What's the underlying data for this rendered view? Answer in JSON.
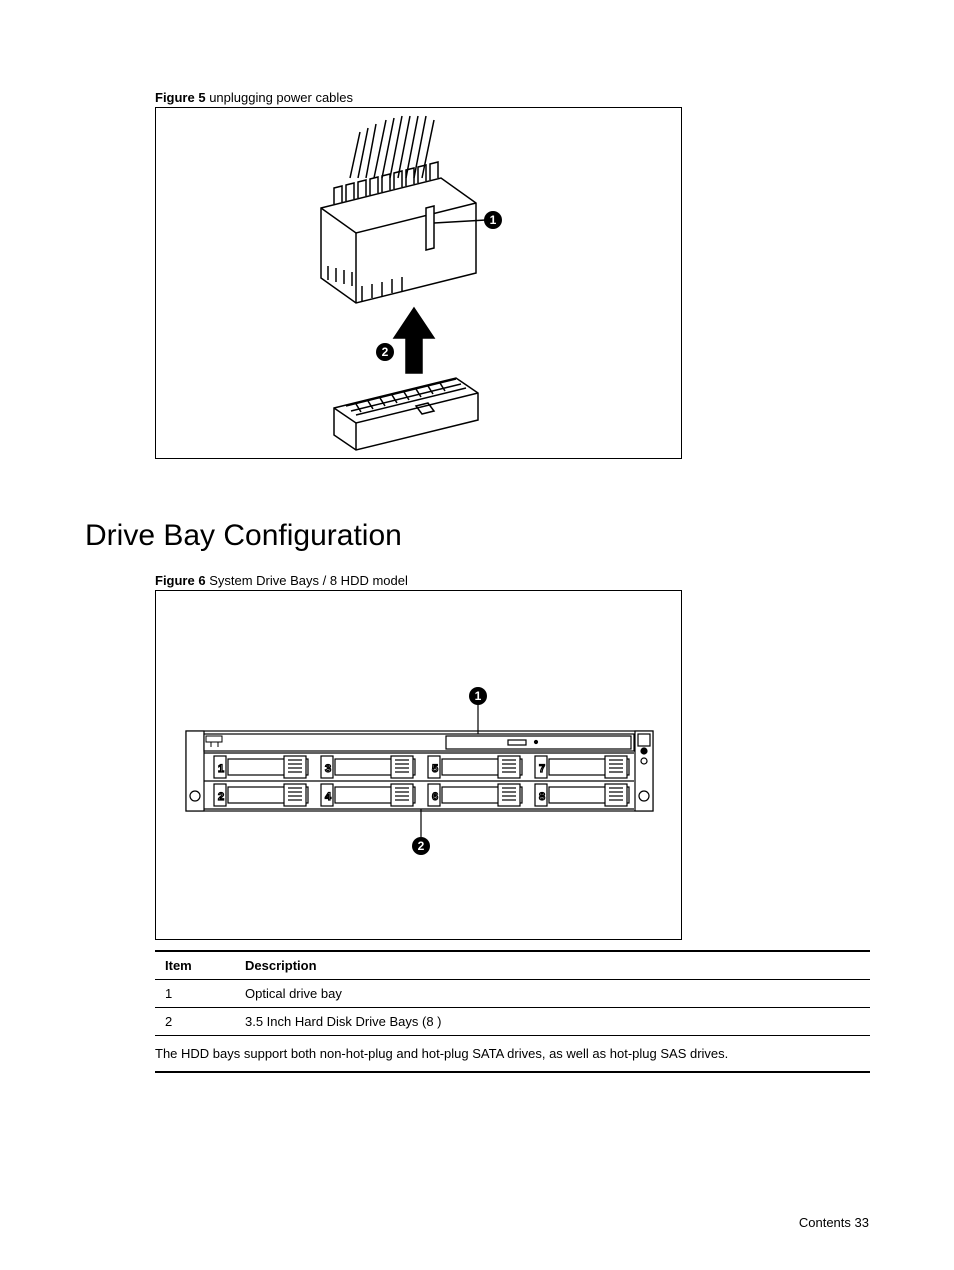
{
  "figure5": {
    "label": "Figure 5",
    "caption": "unplugging power cables",
    "callouts": [
      "1",
      "2"
    ]
  },
  "section_heading": "Drive Bay Configuration",
  "figure6": {
    "label": "Figure 6",
    "caption": "System Drive Bays / 8 HDD model",
    "callouts": [
      "1",
      "2"
    ],
    "bay_numbers": [
      "1",
      "2",
      "3",
      "4",
      "5",
      "6",
      "7",
      "8"
    ]
  },
  "table": {
    "headers": {
      "item": "Item",
      "description": "Description"
    },
    "rows": [
      {
        "item": "1",
        "description": "Optical drive bay"
      },
      {
        "item": "2",
        "description": "3.5 Inch Hard Disk Drive Bays (8 )"
      }
    ],
    "note": "The HDD bays support both non-hot-plug and hot-plug SATA drives, as well as hot-plug SAS drives."
  },
  "footer": {
    "section": "Contents",
    "page": "33"
  }
}
